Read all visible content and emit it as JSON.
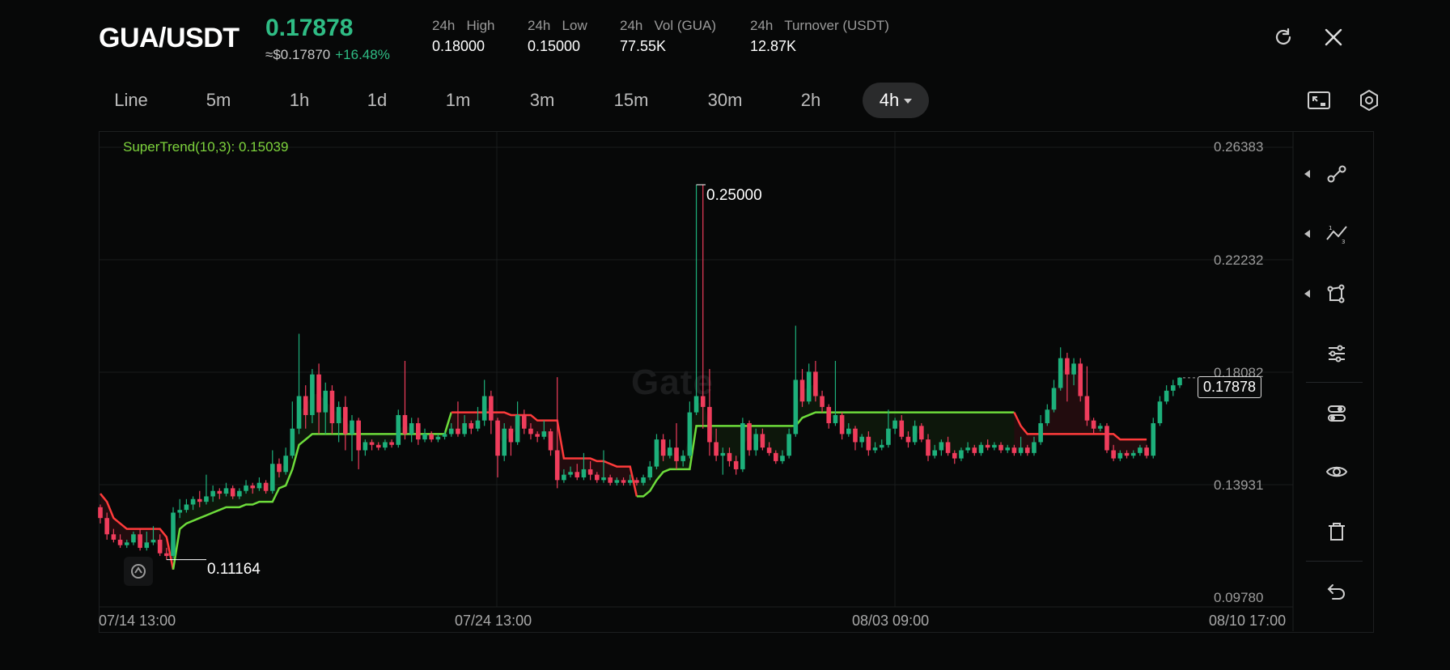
{
  "header": {
    "pair": "GUA/USDT",
    "last_price": "0.17878",
    "usd_price": "≈$0.17870",
    "change": "+16.48%",
    "stats": [
      {
        "label": "24h   High",
        "value": "0.18000"
      },
      {
        "label": "24h   Low",
        "value": "0.15000"
      },
      {
        "label": "24h   Vol (GUA)",
        "value": "77.55K"
      },
      {
        "label": "24h   Turnover (USDT)",
        "value": "12.87K"
      }
    ]
  },
  "timeframes": [
    "Line",
    "5m",
    "1h",
    "1d",
    "1m",
    "3m",
    "15m",
    "30m",
    "2h",
    "4h"
  ],
  "active_timeframe": "4h",
  "chart": {
    "indicator": "SuperTrend(10,3): 0.15039",
    "watermark": "Gate",
    "y_labels": [
      "0.26383",
      "0.22232",
      "0.18082",
      "0.13931",
      "0.09780"
    ],
    "x_labels": [
      "07/14 13:00",
      "07/24 13:00",
      "08/03 09:00",
      "08/10 17:00"
    ],
    "last_price_label": "0.17878",
    "high_annotation": "0.25000",
    "low_annotation": "0.11164"
  },
  "chart_data": {
    "type": "candlestick",
    "title": "",
    "ylim": [
      0.0978,
      0.26383
    ],
    "x_ticks": [
      "07/14 13:00",
      "07/24 13:00",
      "08/03 09:00",
      "08/10 17:00"
    ],
    "highest": 0.25,
    "lowest": 0.11164,
    "last": 0.17878,
    "supertrend_value": 0.15039,
    "colors": {
      "up": "#1db07b",
      "down": "#ef3d5c",
      "supertrend_up": "#6ddc3b",
      "supertrend_down": "#ff3b3b"
    },
    "candles": [
      {
        "o": 0.131,
        "c": 0.127,
        "h": 0.132,
        "l": 0.125
      },
      {
        "o": 0.127,
        "c": 0.121,
        "h": 0.129,
        "l": 0.119
      },
      {
        "o": 0.121,
        "c": 0.119,
        "h": 0.123,
        "l": 0.118
      },
      {
        "o": 0.119,
        "c": 0.117,
        "h": 0.121,
        "l": 0.116
      },
      {
        "o": 0.117,
        "c": 0.118,
        "h": 0.119,
        "l": 0.116
      },
      {
        "o": 0.118,
        "c": 0.121,
        "h": 0.122,
        "l": 0.117
      },
      {
        "o": 0.121,
        "c": 0.116,
        "h": 0.123,
        "l": 0.115
      },
      {
        "o": 0.116,
        "c": 0.118,
        "h": 0.122,
        "l": 0.115
      },
      {
        "o": 0.118,
        "c": 0.119,
        "h": 0.124,
        "l": 0.117
      },
      {
        "o": 0.119,
        "c": 0.114,
        "h": 0.121,
        "l": 0.113
      },
      {
        "o": 0.114,
        "c": 0.113,
        "h": 0.116,
        "l": 0.1116
      },
      {
        "o": 0.113,
        "c": 0.129,
        "h": 0.131,
        "l": 0.112
      },
      {
        "o": 0.129,
        "c": 0.13,
        "h": 0.134,
        "l": 0.127
      },
      {
        "o": 0.13,
        "c": 0.132,
        "h": 0.134,
        "l": 0.129
      },
      {
        "o": 0.132,
        "c": 0.134,
        "h": 0.135,
        "l": 0.13
      },
      {
        "o": 0.134,
        "c": 0.133,
        "h": 0.137,
        "l": 0.131
      },
      {
        "o": 0.133,
        "c": 0.135,
        "h": 0.143,
        "l": 0.132
      },
      {
        "o": 0.135,
        "c": 0.137,
        "h": 0.139,
        "l": 0.133
      },
      {
        "o": 0.137,
        "c": 0.136,
        "h": 0.138,
        "l": 0.134
      },
      {
        "o": 0.136,
        "c": 0.138,
        "h": 0.14,
        "l": 0.135
      },
      {
        "o": 0.138,
        "c": 0.135,
        "h": 0.139,
        "l": 0.134
      },
      {
        "o": 0.135,
        "c": 0.137,
        "h": 0.138,
        "l": 0.134
      },
      {
        "o": 0.137,
        "c": 0.139,
        "h": 0.141,
        "l": 0.136
      },
      {
        "o": 0.139,
        "c": 0.138,
        "h": 0.14,
        "l": 0.136
      },
      {
        "o": 0.138,
        "c": 0.14,
        "h": 0.142,
        "l": 0.137
      },
      {
        "o": 0.14,
        "c": 0.137,
        "h": 0.141,
        "l": 0.136
      },
      {
        "o": 0.137,
        "c": 0.147,
        "h": 0.152,
        "l": 0.136
      },
      {
        "o": 0.147,
        "c": 0.144,
        "h": 0.149,
        "l": 0.142
      },
      {
        "o": 0.144,
        "c": 0.15,
        "h": 0.153,
        "l": 0.143
      },
      {
        "o": 0.15,
        "c": 0.16,
        "h": 0.17,
        "l": 0.149
      },
      {
        "o": 0.16,
        "c": 0.172,
        "h": 0.195,
        "l": 0.158
      },
      {
        "o": 0.172,
        "c": 0.165,
        "h": 0.176,
        "l": 0.16
      },
      {
        "o": 0.165,
        "c": 0.18,
        "h": 0.182,
        "l": 0.162
      },
      {
        "o": 0.18,
        "c": 0.166,
        "h": 0.184,
        "l": 0.158
      },
      {
        "o": 0.166,
        "c": 0.174,
        "h": 0.177,
        "l": 0.158
      },
      {
        "o": 0.174,
        "c": 0.162,
        "h": 0.176,
        "l": 0.158
      },
      {
        "o": 0.162,
        "c": 0.168,
        "h": 0.17,
        "l": 0.155
      },
      {
        "o": 0.168,
        "c": 0.158,
        "h": 0.172,
        "l": 0.152
      },
      {
        "o": 0.158,
        "c": 0.163,
        "h": 0.165,
        "l": 0.148
      },
      {
        "o": 0.163,
        "c": 0.152,
        "h": 0.164,
        "l": 0.145
      },
      {
        "o": 0.152,
        "c": 0.155,
        "h": 0.156,
        "l": 0.15
      },
      {
        "o": 0.155,
        "c": 0.154,
        "h": 0.156,
        "l": 0.152
      },
      {
        "o": 0.154,
        "c": 0.153,
        "h": 0.155,
        "l": 0.152
      },
      {
        "o": 0.153,
        "c": 0.155,
        "h": 0.156,
        "l": 0.152
      },
      {
        "o": 0.155,
        "c": 0.154,
        "h": 0.156,
        "l": 0.153
      },
      {
        "o": 0.154,
        "c": 0.165,
        "h": 0.167,
        "l": 0.153
      },
      {
        "o": 0.165,
        "c": 0.158,
        "h": 0.185,
        "l": 0.156
      },
      {
        "o": 0.158,
        "c": 0.162,
        "h": 0.164,
        "l": 0.155
      },
      {
        "o": 0.162,
        "c": 0.156,
        "h": 0.164,
        "l": 0.154
      },
      {
        "o": 0.156,
        "c": 0.158,
        "h": 0.16,
        "l": 0.155
      },
      {
        "o": 0.158,
        "c": 0.156,
        "h": 0.159,
        "l": 0.155
      },
      {
        "o": 0.156,
        "c": 0.157,
        "h": 0.158,
        "l": 0.155
      },
      {
        "o": 0.157,
        "c": 0.158,
        "h": 0.159,
        "l": 0.156
      },
      {
        "o": 0.158,
        "c": 0.16,
        "h": 0.162,
        "l": 0.157
      },
      {
        "o": 0.16,
        "c": 0.158,
        "h": 0.17,
        "l": 0.157
      },
      {
        "o": 0.158,
        "c": 0.162,
        "h": 0.165,
        "l": 0.157
      },
      {
        "o": 0.162,
        "c": 0.16,
        "h": 0.163,
        "l": 0.158
      },
      {
        "o": 0.16,
        "c": 0.163,
        "h": 0.168,
        "l": 0.159
      },
      {
        "o": 0.163,
        "c": 0.172,
        "h": 0.178,
        "l": 0.161
      },
      {
        "o": 0.172,
        "c": 0.163,
        "h": 0.174,
        "l": 0.158
      },
      {
        "o": 0.163,
        "c": 0.15,
        "h": 0.164,
        "l": 0.142
      },
      {
        "o": 0.15,
        "c": 0.16,
        "h": 0.162,
        "l": 0.148
      },
      {
        "o": 0.16,
        "c": 0.155,
        "h": 0.161,
        "l": 0.15
      },
      {
        "o": 0.155,
        "c": 0.165,
        "h": 0.17,
        "l": 0.154
      },
      {
        "o": 0.165,
        "c": 0.16,
        "h": 0.167,
        "l": 0.158
      },
      {
        "o": 0.16,
        "c": 0.158,
        "h": 0.162,
        "l": 0.156
      },
      {
        "o": 0.158,
        "c": 0.157,
        "h": 0.159,
        "l": 0.155
      },
      {
        "o": 0.157,
        "c": 0.159,
        "h": 0.163,
        "l": 0.156
      },
      {
        "o": 0.159,
        "c": 0.152,
        "h": 0.16,
        "l": 0.15
      },
      {
        "o": 0.152,
        "c": 0.141,
        "h": 0.179,
        "l": 0.138
      },
      {
        "o": 0.141,
        "c": 0.143,
        "h": 0.145,
        "l": 0.14
      },
      {
        "o": 0.143,
        "c": 0.144,
        "h": 0.146,
        "l": 0.142
      },
      {
        "o": 0.144,
        "c": 0.142,
        "h": 0.147,
        "l": 0.141
      },
      {
        "o": 0.142,
        "c": 0.145,
        "h": 0.151,
        "l": 0.141
      },
      {
        "o": 0.145,
        "c": 0.143,
        "h": 0.148,
        "l": 0.141
      },
      {
        "o": 0.143,
        "c": 0.141,
        "h": 0.144,
        "l": 0.14
      },
      {
        "o": 0.141,
        "c": 0.142,
        "h": 0.152,
        "l": 0.14
      },
      {
        "o": 0.142,
        "c": 0.14,
        "h": 0.143,
        "l": 0.139
      },
      {
        "o": 0.14,
        "c": 0.141,
        "h": 0.142,
        "l": 0.139
      },
      {
        "o": 0.141,
        "c": 0.14,
        "h": 0.142,
        "l": 0.139
      },
      {
        "o": 0.14,
        "c": 0.141,
        "h": 0.143,
        "l": 0.139
      },
      {
        "o": 0.141,
        "c": 0.14,
        "h": 0.142,
        "l": 0.139
      },
      {
        "o": 0.14,
        "c": 0.142,
        "h": 0.143,
        "l": 0.139
      },
      {
        "o": 0.142,
        "c": 0.146,
        "h": 0.148,
        "l": 0.141
      },
      {
        "o": 0.146,
        "c": 0.156,
        "h": 0.158,
        "l": 0.145
      },
      {
        "o": 0.156,
        "c": 0.15,
        "h": 0.158,
        "l": 0.148
      },
      {
        "o": 0.15,
        "c": 0.153,
        "h": 0.156,
        "l": 0.149
      },
      {
        "o": 0.153,
        "c": 0.148,
        "h": 0.162,
        "l": 0.145
      },
      {
        "o": 0.148,
        "c": 0.15,
        "h": 0.152,
        "l": 0.146
      },
      {
        "o": 0.15,
        "c": 0.166,
        "h": 0.17,
        "l": 0.149
      },
      {
        "o": 0.166,
        "c": 0.172,
        "h": 0.25,
        "l": 0.165
      },
      {
        "o": 0.172,
        "c": 0.168,
        "h": 0.25,
        "l": 0.16
      },
      {
        "o": 0.168,
        "c": 0.155,
        "h": 0.182,
        "l": 0.15
      },
      {
        "o": 0.155,
        "c": 0.15,
        "h": 0.16,
        "l": 0.148
      },
      {
        "o": 0.15,
        "c": 0.151,
        "h": 0.153,
        "l": 0.143
      },
      {
        "o": 0.151,
        "c": 0.148,
        "h": 0.153,
        "l": 0.146
      },
      {
        "o": 0.148,
        "c": 0.145,
        "h": 0.15,
        "l": 0.143
      },
      {
        "o": 0.145,
        "c": 0.162,
        "h": 0.164,
        "l": 0.144
      },
      {
        "o": 0.162,
        "c": 0.152,
        "h": 0.163,
        "l": 0.15
      },
      {
        "o": 0.152,
        "c": 0.158,
        "h": 0.16,
        "l": 0.15
      },
      {
        "o": 0.158,
        "c": 0.153,
        "h": 0.16,
        "l": 0.152
      },
      {
        "o": 0.153,
        "c": 0.151,
        "h": 0.155,
        "l": 0.15
      },
      {
        "o": 0.151,
        "c": 0.148,
        "h": 0.152,
        "l": 0.147
      },
      {
        "o": 0.148,
        "c": 0.15,
        "h": 0.152,
        "l": 0.147
      },
      {
        "o": 0.15,
        "c": 0.158,
        "h": 0.16,
        "l": 0.149
      },
      {
        "o": 0.158,
        "c": 0.178,
        "h": 0.198,
        "l": 0.157
      },
      {
        "o": 0.178,
        "c": 0.17,
        "h": 0.182,
        "l": 0.168
      },
      {
        "o": 0.17,
        "c": 0.181,
        "h": 0.184,
        "l": 0.169
      },
      {
        "o": 0.181,
        "c": 0.172,
        "h": 0.185,
        "l": 0.17
      },
      {
        "o": 0.172,
        "c": 0.168,
        "h": 0.174,
        "l": 0.166
      },
      {
        "o": 0.168,
        "c": 0.162,
        "h": 0.169,
        "l": 0.16
      },
      {
        "o": 0.162,
        "c": 0.165,
        "h": 0.185,
        "l": 0.161
      },
      {
        "o": 0.165,
        "c": 0.158,
        "h": 0.166,
        "l": 0.156
      },
      {
        "o": 0.158,
        "c": 0.16,
        "h": 0.162,
        "l": 0.157
      },
      {
        "o": 0.16,
        "c": 0.155,
        "h": 0.161,
        "l": 0.152
      },
      {
        "o": 0.155,
        "c": 0.157,
        "h": 0.158,
        "l": 0.153
      },
      {
        "o": 0.157,
        "c": 0.152,
        "h": 0.159,
        "l": 0.15
      },
      {
        "o": 0.152,
        "c": 0.153,
        "h": 0.155,
        "l": 0.151
      },
      {
        "o": 0.153,
        "c": 0.154,
        "h": 0.156,
        "l": 0.152
      },
      {
        "o": 0.154,
        "c": 0.16,
        "h": 0.167,
        "l": 0.153
      },
      {
        "o": 0.16,
        "c": 0.163,
        "h": 0.164,
        "l": 0.158
      },
      {
        "o": 0.163,
        "c": 0.157,
        "h": 0.165,
        "l": 0.156
      },
      {
        "o": 0.157,
        "c": 0.155,
        "h": 0.159,
        "l": 0.153
      },
      {
        "o": 0.155,
        "c": 0.161,
        "h": 0.163,
        "l": 0.154
      },
      {
        "o": 0.161,
        "c": 0.156,
        "h": 0.162,
        "l": 0.155
      },
      {
        "o": 0.156,
        "c": 0.15,
        "h": 0.158,
        "l": 0.148
      },
      {
        "o": 0.15,
        "c": 0.152,
        "h": 0.154,
        "l": 0.149
      },
      {
        "o": 0.152,
        "c": 0.155,
        "h": 0.156,
        "l": 0.15
      },
      {
        "o": 0.155,
        "c": 0.151,
        "h": 0.157,
        "l": 0.15
      },
      {
        "o": 0.151,
        "c": 0.149,
        "h": 0.152,
        "l": 0.147
      },
      {
        "o": 0.149,
        "c": 0.152,
        "h": 0.153,
        "l": 0.148
      },
      {
        "o": 0.152,
        "c": 0.153,
        "h": 0.155,
        "l": 0.151
      },
      {
        "o": 0.153,
        "c": 0.151,
        "h": 0.154,
        "l": 0.15
      },
      {
        "o": 0.151,
        "c": 0.154,
        "h": 0.155,
        "l": 0.15
      },
      {
        "o": 0.154,
        "c": 0.153,
        "h": 0.156,
        "l": 0.152
      },
      {
        "o": 0.153,
        "c": 0.154,
        "h": 0.155,
        "l": 0.152
      },
      {
        "o": 0.154,
        "c": 0.152,
        "h": 0.155,
        "l": 0.151
      },
      {
        "o": 0.152,
        "c": 0.153,
        "h": 0.154,
        "l": 0.151
      },
      {
        "o": 0.153,
        "c": 0.151,
        "h": 0.154,
        "l": 0.15
      },
      {
        "o": 0.151,
        "c": 0.153,
        "h": 0.157,
        "l": 0.15
      },
      {
        "o": 0.153,
        "c": 0.151,
        "h": 0.154,
        "l": 0.15
      },
      {
        "o": 0.151,
        "c": 0.155,
        "h": 0.157,
        "l": 0.15
      },
      {
        "o": 0.155,
        "c": 0.162,
        "h": 0.165,
        "l": 0.154
      },
      {
        "o": 0.162,
        "c": 0.167,
        "h": 0.169,
        "l": 0.161
      },
      {
        "o": 0.167,
        "c": 0.175,
        "h": 0.178,
        "l": 0.166
      },
      {
        "o": 0.175,
        "c": 0.186,
        "h": 0.19,
        "l": 0.174
      },
      {
        "o": 0.186,
        "c": 0.18,
        "h": 0.188,
        "l": 0.17
      },
      {
        "o": 0.18,
        "c": 0.184,
        "h": 0.186,
        "l": 0.176
      },
      {
        "o": 0.184,
        "c": 0.172,
        "h": 0.186,
        "l": 0.17
      },
      {
        "o": 0.172,
        "c": 0.163,
        "h": 0.183,
        "l": 0.161
      },
      {
        "o": 0.163,
        "c": 0.16,
        "h": 0.164,
        "l": 0.158
      },
      {
        "o": 0.16,
        "c": 0.161,
        "h": 0.162,
        "l": 0.159
      },
      {
        "o": 0.161,
        "c": 0.152,
        "h": 0.162,
        "l": 0.151
      },
      {
        "o": 0.152,
        "c": 0.149,
        "h": 0.154,
        "l": 0.148
      },
      {
        "o": 0.149,
        "c": 0.151,
        "h": 0.152,
        "l": 0.148
      },
      {
        "o": 0.151,
        "c": 0.15,
        "h": 0.152,
        "l": 0.149
      },
      {
        "o": 0.15,
        "c": 0.151,
        "h": 0.152,
        "l": 0.149
      },
      {
        "o": 0.151,
        "c": 0.153,
        "h": 0.154,
        "l": 0.15
      },
      {
        "o": 0.153,
        "c": 0.15,
        "h": 0.154,
        "l": 0.149
      },
      {
        "o": 0.15,
        "c": 0.162,
        "h": 0.164,
        "l": 0.149
      },
      {
        "o": 0.162,
        "c": 0.17,
        "h": 0.172,
        "l": 0.161
      },
      {
        "o": 0.17,
        "c": 0.174,
        "h": 0.176,
        "l": 0.169
      },
      {
        "o": 0.174,
        "c": 0.176,
        "h": 0.178,
        "l": 0.172
      },
      {
        "o": 0.176,
        "c": 0.1788,
        "h": 0.179,
        "l": 0.175
      }
    ],
    "supertrend_segments": [
      {
        "dir": "down",
        "from": 0,
        "to": 11
      },
      {
        "dir": "up",
        "from": 11,
        "to": 53
      },
      {
        "dir": "down",
        "from": 53,
        "to": 81
      },
      {
        "dir": "up",
        "from": 81,
        "to": 138
      },
      {
        "dir": "down",
        "from": 138,
        "to": 158
      }
    ]
  },
  "tools": [
    {
      "name": "trend-line-tool-icon",
      "has_caret": true
    },
    {
      "name": "fib-tool-icon",
      "has_caret": true
    },
    {
      "name": "shape-tool-icon",
      "has_caret": true
    },
    {
      "name": "indicator-settings-icon",
      "has_caret": false
    },
    {
      "name": "layers-icon",
      "has_caret": false
    },
    {
      "name": "eye-icon",
      "has_caret": false
    },
    {
      "name": "trash-icon",
      "has_caret": false
    },
    {
      "name": "undo-icon",
      "has_caret": false
    }
  ]
}
